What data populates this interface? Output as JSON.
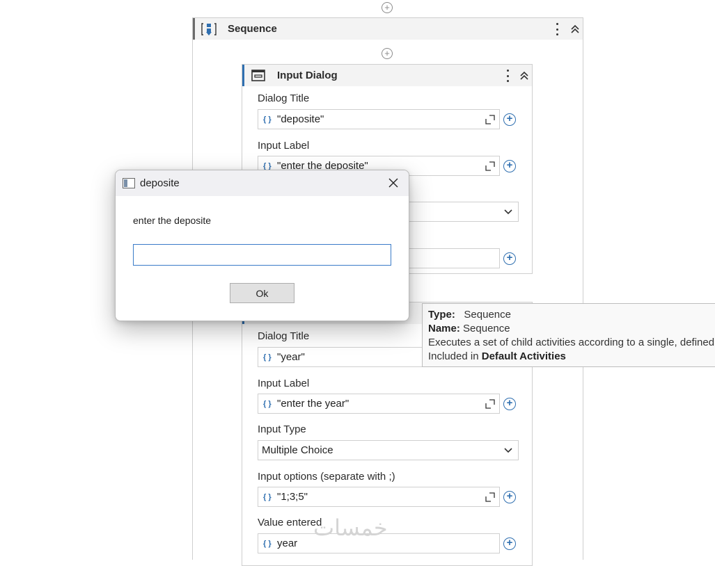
{
  "sequence": {
    "title": "Sequence",
    "icon": "sequence-icon"
  },
  "card1": {
    "title": "Input Dialog",
    "icon": "window-icon",
    "dialog_title_label": "Dialog Title",
    "dialog_title_value": "\"deposite\"",
    "input_label_label": "Input Label",
    "input_label_value": "\"enter the deposite\""
  },
  "card2": {
    "dialog_title_label": "Dialog Title",
    "dialog_title_value": "\"year\"",
    "input_label_label": "Input Label",
    "input_label_value": "\"enter the year\"",
    "input_type_label": "Input Type",
    "input_type_value": "Multiple Choice",
    "input_options_label": "Input options (separate with ;)",
    "input_options_value": "\"1;3;5\"",
    "value_entered_label": "Value entered",
    "value_entered_value": "year"
  },
  "brace_symbol": "{ }",
  "tooltip": {
    "type_label": "Type:",
    "type_value": "Sequence",
    "name_label": "Name:",
    "name_value": "Sequence",
    "description": "Executes a set of child activities according to a single, defined ordering.",
    "included_prefix": "Included in",
    "included_value": "Default Activities"
  },
  "dialog": {
    "title": "deposite",
    "prompt": "enter the deposite",
    "input_value": "",
    "ok_label": "Ok"
  },
  "watermark": "خمسات",
  "colors": {
    "accent": "#2f6fb0",
    "header_bg": "#f3f3f3",
    "tooltip_bg": "#f9f9f9",
    "dialog_titlebar": "#f0f0f3"
  }
}
